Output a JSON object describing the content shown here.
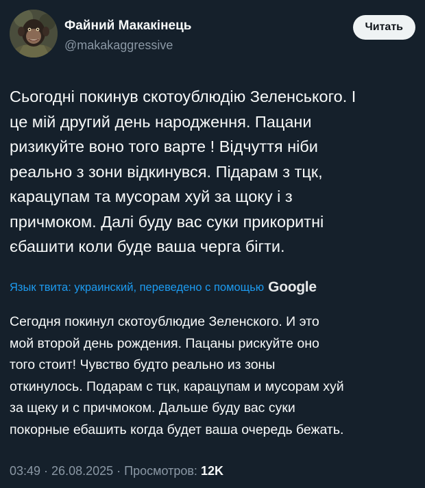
{
  "author": {
    "display_name": "Файний Макакінець",
    "handle": "@makakaggressive"
  },
  "follow_button": {
    "label": "Читать"
  },
  "tweet": {
    "lines": [
      "Сьогодні покинув скотоублюдію Зеленського. І",
      "це мій другий день народження. Пацани",
      "ризикуйте воно того варте ! Відчуття ніби",
      "реально з зони відкинувся. Підарам з тцк,",
      "карацупам та мусорам хуй за щоку і з",
      "причмоком. Далі буду вас суки прикоритні",
      "єбашити коли буде ваша черга бігти."
    ]
  },
  "translation": {
    "label": "Язык твита: украинский, переведено с помощью",
    "provider": "Google",
    "lines": [
      "Сегодня покинул скотоублюдие Зеленского. И это",
      "мой второй день рождения. Пацаны рискуйте оно",
      "того стоит! Чувство будто реально из зоны",
      "откинулось. Подарам с тцк, карацупам и мусорам хуй",
      "за щеку и с причмоком. Дальше буду вас суки",
      "покорные ебашить когда будет ваша очередь бежать."
    ]
  },
  "meta": {
    "time": "03:49",
    "date": "26.08.2025",
    "views_label": "Просмотров:",
    "views_count": "12K"
  },
  "colors": {
    "background": "#15202b",
    "text": "#f7f9f9",
    "secondary": "#8b98a5",
    "accent": "#1d9bf0",
    "button_bg": "#eff3f4"
  },
  "icons": {
    "avatar": "monkey-soldier-avatar"
  }
}
